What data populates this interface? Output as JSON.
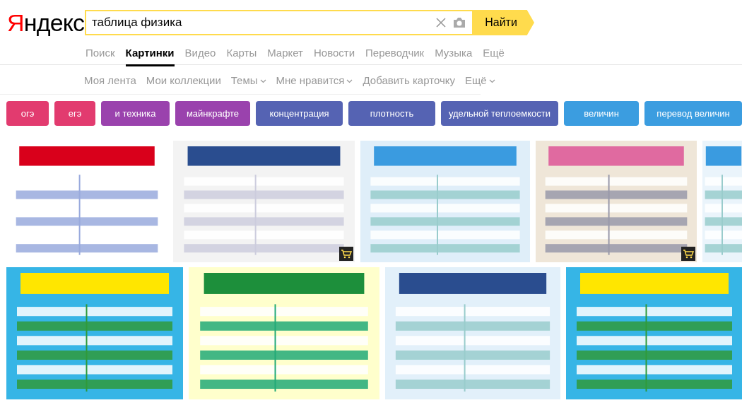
{
  "logo": {
    "text": "Яндекс"
  },
  "search": {
    "value": "таблица физика",
    "button": "Найти"
  },
  "tabs": [
    {
      "label": "Поиск",
      "selected": false
    },
    {
      "label": "Картинки",
      "selected": true
    },
    {
      "label": "Видео",
      "selected": false
    },
    {
      "label": "Карты",
      "selected": false
    },
    {
      "label": "Маркет",
      "selected": false
    },
    {
      "label": "Новости",
      "selected": false
    },
    {
      "label": "Переводчик",
      "selected": false
    },
    {
      "label": "Музыка",
      "selected": false
    },
    {
      "label": "Ещё",
      "selected": false
    }
  ],
  "submenu": [
    {
      "label": "Моя лента",
      "dropdown": false
    },
    {
      "label": "Мои коллекции",
      "dropdown": false
    },
    {
      "label": "Темы",
      "dropdown": true
    },
    {
      "label": "Мне нравится",
      "dropdown": true
    },
    {
      "label": "Добавить карточку",
      "dropdown": false
    },
    {
      "label": "Ещё",
      "dropdown": true
    }
  ],
  "chips": [
    {
      "label": "огэ",
      "color": "#e23b6f"
    },
    {
      "label": "егэ",
      "color": "#e23b6f"
    },
    {
      "label": "и техника",
      "color": "#9a42ad"
    },
    {
      "label": "майнкрафте",
      "color": "#9a42ad"
    },
    {
      "label": "концентрация",
      "color": "#5563b3"
    },
    {
      "label": "плотность",
      "color": "#5563b3"
    },
    {
      "label": "удельной теплоемкости",
      "color": "#5563b3"
    },
    {
      "label": "величин",
      "color": "#3b9de0"
    },
    {
      "label": "перевод величин",
      "color": "#3b9de0"
    }
  ],
  "results": [
    [
      {
        "kind": "picture",
        "cart": false
      },
      {
        "kind": "picture",
        "cart": true
      },
      {
        "kind": "picture",
        "cart": false
      },
      {
        "kind": "picture",
        "cart": true
      },
      {
        "kind": "picture",
        "cart": false
      }
    ],
    [
      {
        "kind": "picture",
        "cart": false
      },
      {
        "kind": "picture",
        "cart": false
      },
      {
        "kind": "picture",
        "cart": false
      },
      {
        "kind": "picture",
        "cart": false
      }
    ]
  ]
}
